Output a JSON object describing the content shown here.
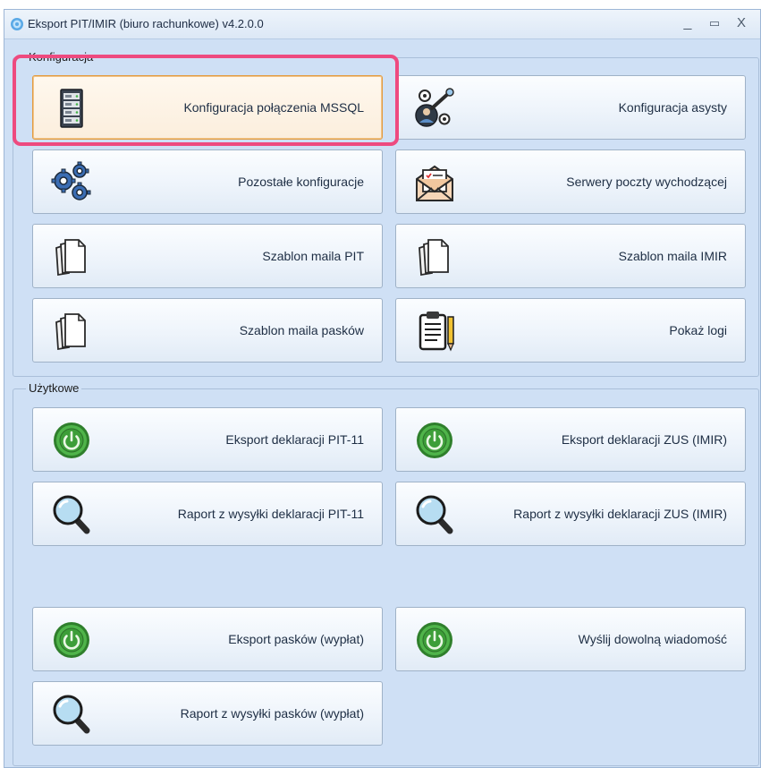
{
  "window": {
    "title": "Eksport PIT/IMIR (biuro rachunkowe) v4.2.0.0",
    "minimize_glyph": "_",
    "maximize_glyph": "▭",
    "close_glyph": "X"
  },
  "colors": {
    "accent_highlight": "#ee4a7f",
    "window_bg": "#cfe0f5",
    "power_green": "#3fa43b"
  },
  "groups": {
    "config": "Konfiguracja",
    "utility": "Użytkowe"
  },
  "buttons": {
    "mssql": {
      "label": "Konfiguracja połączenia MSSQL",
      "icon": "server-icon"
    },
    "asysta": {
      "label": "Konfiguracja asysty",
      "icon": "user-key-icon"
    },
    "pozostale": {
      "label": "Pozostałe konfiguracje",
      "icon": "gears-icon"
    },
    "serwery": {
      "label": "Serwery poczty wychodzącej",
      "icon": "mail-envelope-icon"
    },
    "szablon_pit": {
      "label": "Szablon maila PIT",
      "icon": "documents-icon"
    },
    "szablon_imir": {
      "label": "Szablon maila IMIR",
      "icon": "documents-icon"
    },
    "szablon_paski": {
      "label": "Szablon maila pasków",
      "icon": "documents-icon"
    },
    "logi": {
      "label": "Pokaż logi",
      "icon": "clipboard-icon"
    },
    "eksport_pit": {
      "label": "Eksport deklaracji PIT-11",
      "icon": "power-icon"
    },
    "eksport_zus": {
      "label": "Eksport deklaracji ZUS (IMIR)",
      "icon": "power-icon"
    },
    "raport_pit": {
      "label": "Raport z wysyłki deklaracji PIT-11",
      "icon": "magnifier-icon"
    },
    "raport_zus": {
      "label": "Raport z wysyłki deklaracji ZUS (IMIR)",
      "icon": "magnifier-icon"
    },
    "eksport_paski": {
      "label": "Eksport pasków (wypłat)",
      "icon": "power-icon"
    },
    "wyslij": {
      "label": "Wyślij dowolną wiadomość",
      "icon": "power-icon"
    },
    "raport_paski": {
      "label": "Raport z wysyłki pasków (wypłat)",
      "icon": "magnifier-icon"
    }
  }
}
